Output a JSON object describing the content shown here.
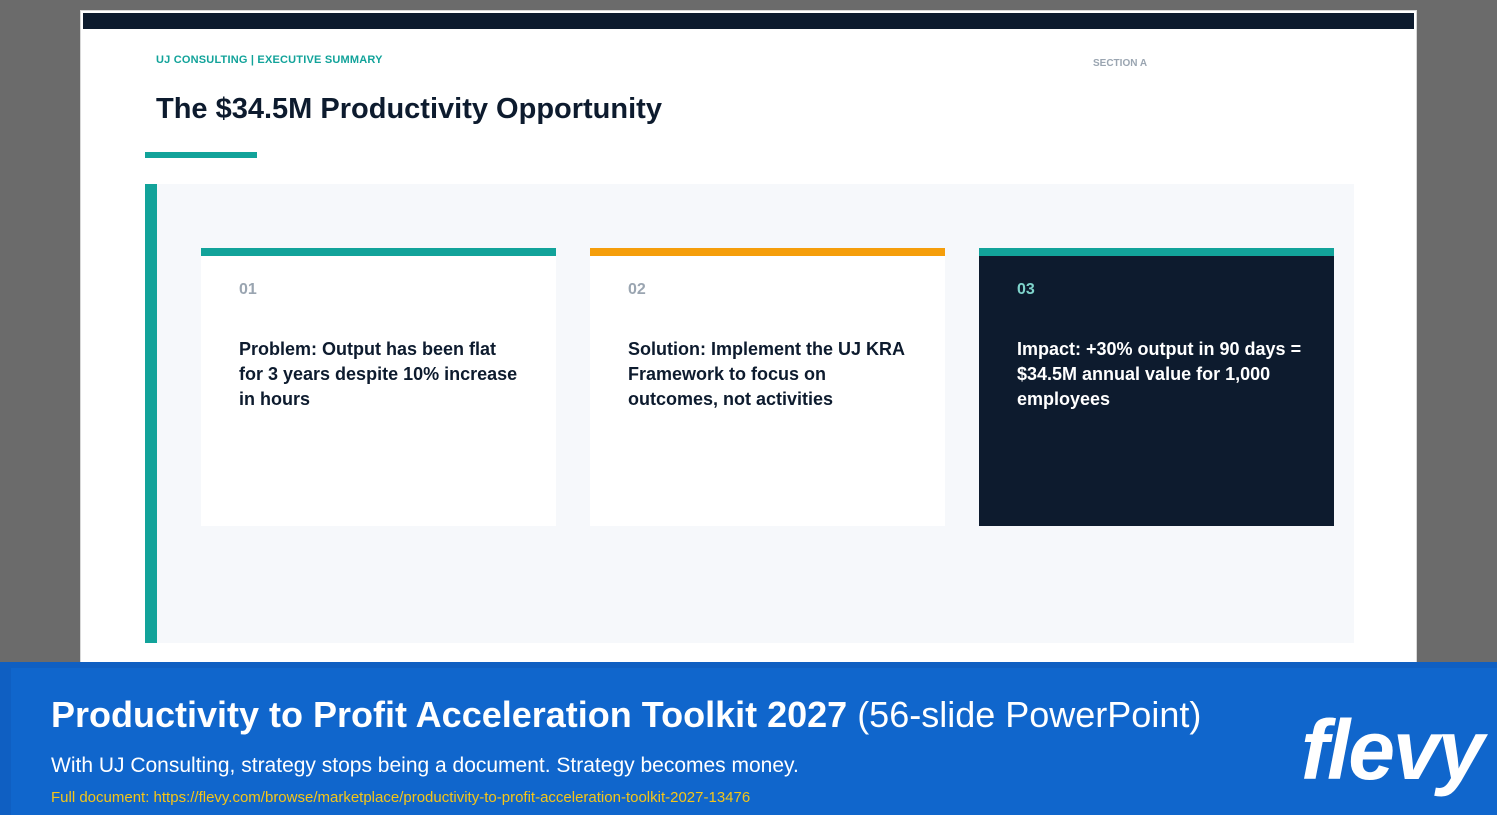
{
  "slide": {
    "eyebrow": "UJ CONSULTING | EXECUTIVE SUMMARY",
    "section": "SECTION A",
    "title": "The $34.5M Productivity Opportunity",
    "cards": [
      {
        "number": "01",
        "text": "Problem: Output has been flat for 3 years despite 10% increase in hours",
        "accent": "#12a39a"
      },
      {
        "number": "02",
        "text": "Solution: Implement the UJ KRA Framework to focus on outcomes, not activities",
        "accent": "#f59e0b"
      },
      {
        "number": "03",
        "text": "Impact: +30% output in 90 days = $34.5M annual value for 1,000 employees",
        "accent": "#12a39a"
      }
    ]
  },
  "banner": {
    "title_bold": "Productivity to Profit Acceleration Toolkit 2027",
    "title_light": "(56-slide PowerPoint)",
    "subtitle": "With UJ Consulting, strategy stops being a document. Strategy becomes money.",
    "link_label": "Full document: ",
    "link_url": "https://flevy.com/browse/marketplace/productivity-to-profit-acceleration-toolkit-2027-13476",
    "logo": "flevy"
  },
  "colors": {
    "navy": "#0d1b2e",
    "teal": "#12a39a",
    "orange": "#f59e0b",
    "banner_blue": "#1066cc",
    "link_yellow": "#f5c518"
  }
}
